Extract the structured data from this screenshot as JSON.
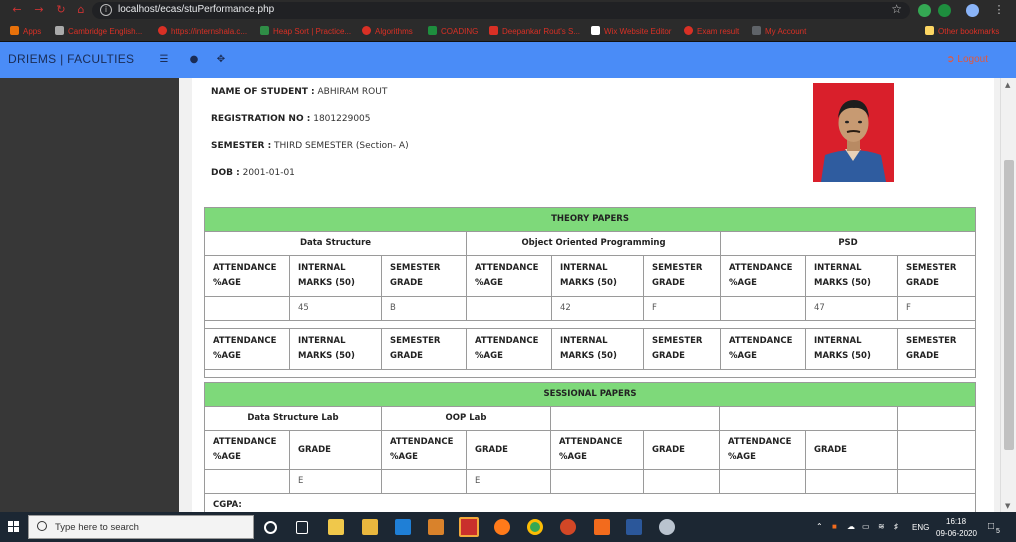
{
  "browser": {
    "url": "localhost/ecas/stuPerformance.php",
    "bookmarks": [
      "Apps",
      "Cambridge English...",
      "https://internshala.c...",
      "Heap Sort | Practice...",
      "Algorithms",
      "COADING",
      "Deepankar Rout's S...",
      "Wix Website Editor",
      "Exam result",
      "My Account",
      "Other bookmarks"
    ]
  },
  "header": {
    "brand": "DRIEMS | FACULTIES",
    "logout": "Logout"
  },
  "student": {
    "name_label": "NAME OF STUDENT :",
    "name": "ABHIRAM ROUT",
    "reg_label": "REGISTRATION NO :",
    "reg": "1801229005",
    "sem_label": "SEMESTER :",
    "sem": "THIRD SEMESTER (Section- A)",
    "dob_label": "DOB :",
    "dob": "2001-01-01"
  },
  "theory": {
    "title": "THEORY PAPERS",
    "subjects": [
      "Data Structure",
      "Object Oriented Programming",
      "PSD"
    ],
    "col_attendance": "ATTENDANCE %AGE",
    "col_internal": "INTERNAL MARKS (50)",
    "col_grade": "SEMESTER GRADE",
    "rows": [
      [
        "",
        "45",
        "B",
        "",
        "42",
        "F",
        "",
        "47",
        "F"
      ]
    ]
  },
  "sessional": {
    "title": "SESSIONAL PAPERS",
    "subjects": [
      "Data Structure Lab",
      "OOP Lab"
    ],
    "col_attendance": "ATTENDANCE %AGE",
    "col_grade": "GRADE",
    "rows": [
      [
        "",
        "E",
        "",
        "E",
        "",
        "",
        "",
        ""
      ]
    ]
  },
  "cgpa_label": "CGPA:",
  "taskbar": {
    "search_placeholder": "Type here to search",
    "lang": "ENG",
    "time": "16:18",
    "date": "09-06-2020",
    "notif_count": "5"
  }
}
